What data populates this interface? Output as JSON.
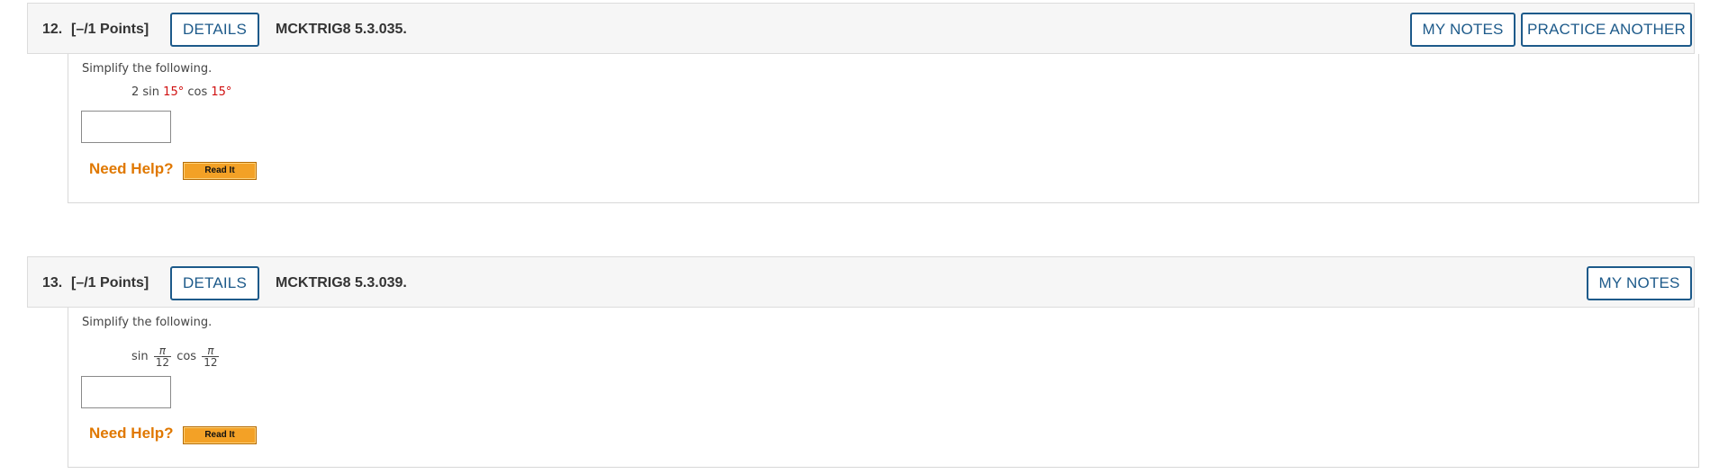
{
  "questions": [
    {
      "number": "12.",
      "points": "[–/1 Points]",
      "details_label": "DETAILS",
      "code": "MCKTRIG8 5.3.035.",
      "my_notes_label": "MY NOTES",
      "practice_another_label": "PRACTICE ANOTHER",
      "prompt": "Simplify the following.",
      "expression": {
        "coef": "2 sin ",
        "angle1": "15°",
        "mid": " cos ",
        "angle2": "15°"
      },
      "answer_value": "",
      "need_help": "Need Help?",
      "read_it_label": "Read It"
    },
    {
      "number": "13.",
      "points": "[–/1 Points]",
      "details_label": "DETAILS",
      "code": "MCKTRIG8 5.3.039.",
      "my_notes_label": "MY NOTES",
      "prompt": "Simplify the following.",
      "expression": {
        "fn1": "sin",
        "num1": "π",
        "den1": "12",
        "fn2": "cos",
        "num2": "π",
        "den2": "12"
      },
      "answer_value": "",
      "need_help": "Need Help?",
      "read_it_label": "Read It"
    }
  ],
  "colors": {
    "accent_blue": "#1d5a8a",
    "need_help_orange": "#e07800",
    "highlight_red": "#d01010",
    "read_it_button": "#f3a126"
  }
}
